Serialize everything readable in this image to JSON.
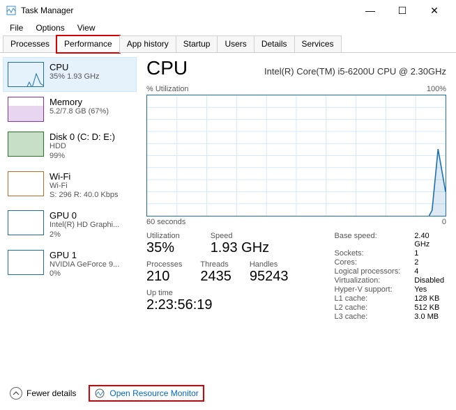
{
  "window": {
    "title": "Task Manager"
  },
  "menu": {
    "file": "File",
    "options": "Options",
    "view": "View"
  },
  "tabs": {
    "processes": "Processes",
    "performance": "Performance",
    "apphistory": "App history",
    "startup": "Startup",
    "users": "Users",
    "details": "Details",
    "services": "Services"
  },
  "sidebar": {
    "cpu": {
      "name": "CPU",
      "sub": "35%  1.93 GHz"
    },
    "memory": {
      "name": "Memory",
      "sub": "5.2/7.8 GB (67%)"
    },
    "disk": {
      "name": "Disk 0 (C: D: E:)",
      "sub1": "HDD",
      "sub2": "99%"
    },
    "wifi": {
      "name": "Wi-Fi",
      "sub1": "Wi-Fi",
      "sub2": "S: 296 R: 40.0 Kbps"
    },
    "gpu0": {
      "name": "GPU 0",
      "sub1": "Intel(R) HD Graphi...",
      "sub2": "2%"
    },
    "gpu1": {
      "name": "GPU 1",
      "sub1": "NVIDIA GeForce 9...",
      "sub2": "0%"
    }
  },
  "main": {
    "title": "CPU",
    "model": "Intel(R) Core(TM) i5-6200U CPU @ 2.30GHz",
    "chart_top_left": "% Utilization",
    "chart_top_right": "100%",
    "chart_bottom_left": "60 seconds",
    "chart_bottom_right": "0",
    "util_label": "Utilization",
    "util_value": "35%",
    "speed_label": "Speed",
    "speed_value": "1.93 GHz",
    "proc_label": "Processes",
    "proc_value": "210",
    "threads_label": "Threads",
    "threads_value": "2435",
    "handles_label": "Handles",
    "handles_value": "95243",
    "uptime_label": "Up time",
    "uptime_value": "2:23:56:19",
    "kv": {
      "base_speed_k": "Base speed:",
      "base_speed_v": "2.40 GHz",
      "sockets_k": "Sockets:",
      "sockets_v": "1",
      "cores_k": "Cores:",
      "cores_v": "2",
      "lp_k": "Logical processors:",
      "lp_v": "4",
      "virt_k": "Virtualization:",
      "virt_v": "Disabled",
      "hv_k": "Hyper-V support:",
      "hv_v": "Yes",
      "l1_k": "L1 cache:",
      "l1_v": "128 KB",
      "l2_k": "L2 cache:",
      "l2_v": "512 KB",
      "l3_k": "L3 cache:",
      "l3_v": "3.0 MB"
    }
  },
  "footer": {
    "fewer": "Fewer details",
    "orm": "Open Resource Monitor"
  },
  "chart_data": {
    "type": "line",
    "title": "% Utilization",
    "xlabel": "60 seconds",
    "ylabel": "% Utilization",
    "ylim": [
      0,
      100
    ],
    "xlim_seconds": [
      60,
      0
    ],
    "series": [
      {
        "name": "CPU % Utilization",
        "x_seconds": [
          60,
          55,
          50,
          45,
          40,
          35,
          30,
          25,
          20,
          15,
          10,
          5,
          2,
          1,
          0
        ],
        "values": [
          0,
          0,
          0,
          0,
          0,
          0,
          0,
          0,
          0,
          0,
          0,
          0,
          5,
          55,
          20
        ]
      }
    ]
  }
}
